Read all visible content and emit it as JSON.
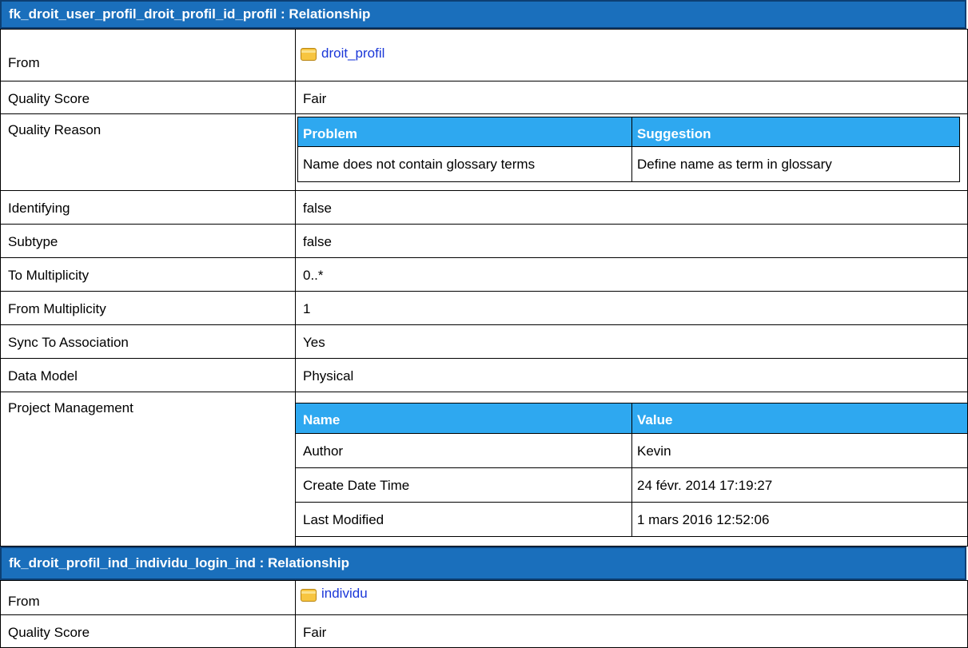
{
  "sections": [
    {
      "title": "fk_droit_user_profil_droit_profil_id_profil : Relationship",
      "from_label": "From",
      "from_value": "droit_profil",
      "quality_score_label": "Quality Score",
      "quality_score_value": "Fair",
      "quality_reason_label": "Quality Reason",
      "quality_reason": {
        "headers": [
          "Problem",
          "Suggestion"
        ],
        "rows": [
          [
            "Name does not contain glossary terms",
            "Define name as term in glossary"
          ]
        ]
      },
      "rows": [
        {
          "label": "Identifying",
          "value": "false"
        },
        {
          "label": "Subtype",
          "value": "false"
        },
        {
          "label": "To Multiplicity",
          "value": "0..*"
        },
        {
          "label": "From Multiplicity",
          "value": "1"
        },
        {
          "label": "Sync To Association",
          "value": "Yes"
        },
        {
          "label": "Data Model",
          "value": "Physical"
        }
      ],
      "project_management_label": "Project Management",
      "project_management": {
        "headers": [
          "Name",
          "Value"
        ],
        "rows": [
          [
            "Author",
            "Kevin"
          ],
          [
            "Create Date Time",
            "24 févr. 2014 17:19:27"
          ],
          [
            "Last Modified",
            "1 mars 2016 12:52:06"
          ]
        ]
      }
    },
    {
      "title": "fk_droit_profil_ind_individu_login_ind : Relationship",
      "from_label": "From",
      "from_value": "individu",
      "quality_score_label": "Quality Score",
      "quality_score_value": "Fair"
    }
  ],
  "icons": {
    "table": "table-icon"
  },
  "colors": {
    "header_bg": "#1a6fbc",
    "subheader_bg": "#2ea8f0",
    "link": "#1a37d8"
  }
}
